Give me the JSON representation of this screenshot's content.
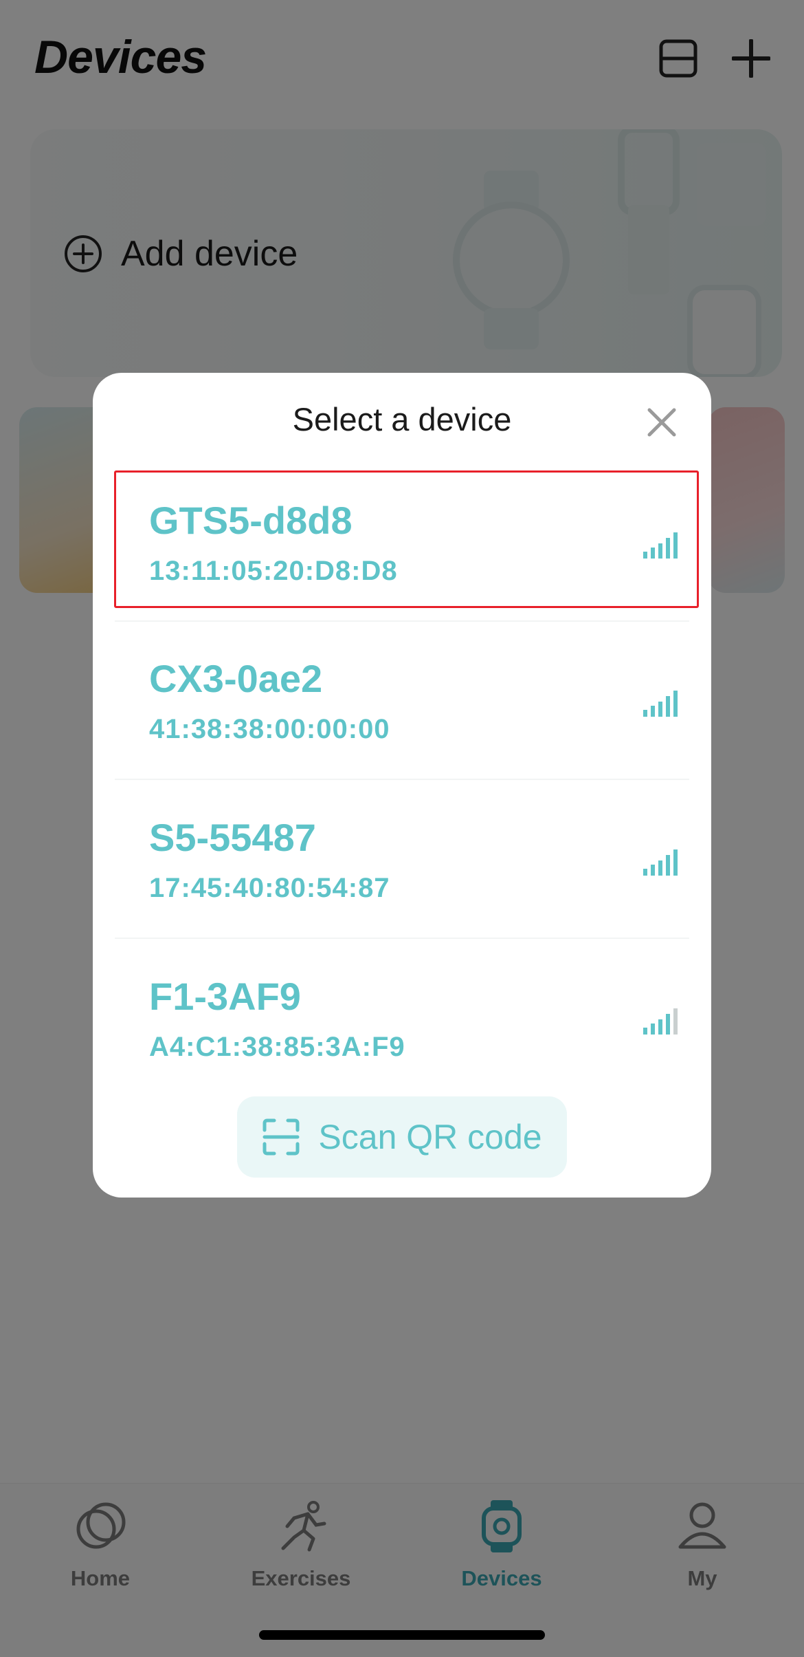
{
  "header": {
    "title": "Devices",
    "list_icon": "list-view-icon",
    "add_icon": "plus-icon"
  },
  "banner": {
    "add_device_label": "Add device",
    "add_icon": "plus-circle-icon"
  },
  "modal": {
    "title": "Select a device",
    "close_icon": "close-icon",
    "devices": [
      {
        "name": "GTS5-d8d8",
        "mac": "13:11:05:20:D8:D8",
        "signal_bars": 5,
        "selected": true
      },
      {
        "name": "CX3-0ae2",
        "mac": "41:38:38:00:00:00",
        "signal_bars": 5,
        "selected": false
      },
      {
        "name": "S5-55487",
        "mac": "17:45:40:80:54:87",
        "signal_bars": 5,
        "selected": false
      },
      {
        "name": "F1-3AF9",
        "mac": "A4:C1:38:85:3A:F9",
        "signal_bars": 4,
        "selected": false
      }
    ],
    "scan_button": {
      "label": "Scan QR code",
      "icon": "qr-scan-icon"
    }
  },
  "tabbar": {
    "tabs": [
      {
        "label": "Home",
        "icon": "home-icon",
        "active": false
      },
      {
        "label": "Exercises",
        "icon": "running-icon",
        "active": false
      },
      {
        "label": "Devices",
        "icon": "watch-icon",
        "active": true
      },
      {
        "label": "My",
        "icon": "profile-icon",
        "active": false
      }
    ]
  },
  "colors": {
    "accent": "#5ec3c8",
    "tab_active": "#3aa7b2",
    "selection_outline": "#e8202a",
    "overlay": "rgba(0,0,0,0.5)"
  }
}
